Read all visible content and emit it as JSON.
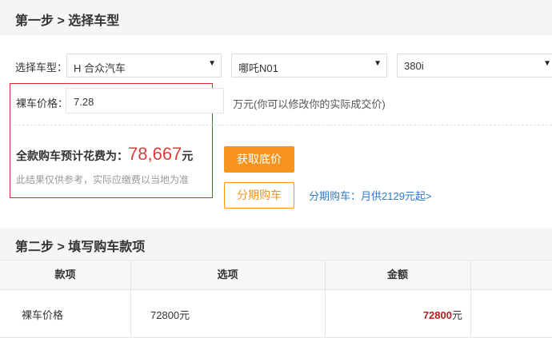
{
  "step1": {
    "title": "第一步 > 选择车型"
  },
  "selector": {
    "label": "选择车型：",
    "brand": "H 合众汽车",
    "series": "哪吒N01",
    "model": "380i",
    "arrow": "▼"
  },
  "price": {
    "label": "裸车价格：",
    "value": "7.28",
    "unit_note": "万元(你可以修改你的实际成交价)"
  },
  "summary": {
    "total_label": "全款购车预计花费为：",
    "total_value": "78,667",
    "total_unit": "元",
    "disclaimer": "此结果仅供参考，实际应缴费以当地为准"
  },
  "buttons": {
    "get_quote": "获取底价",
    "installment": "分期购车",
    "installment_link": "分期购车：月供2129元起>"
  },
  "step2": {
    "title": "第二步 > 填写购车款项"
  },
  "table": {
    "headers": [
      "款项",
      "选项",
      "金额"
    ],
    "rows": [
      {
        "item": "裸车价格",
        "option": "72800元",
        "amount": "72800",
        "amount_unit": "元"
      }
    ]
  },
  "colors": {
    "accent": "#f7941d",
    "price_red": "#e33b3b",
    "link_blue": "#2f7ac6",
    "highlight_box": "#d62c2c"
  }
}
